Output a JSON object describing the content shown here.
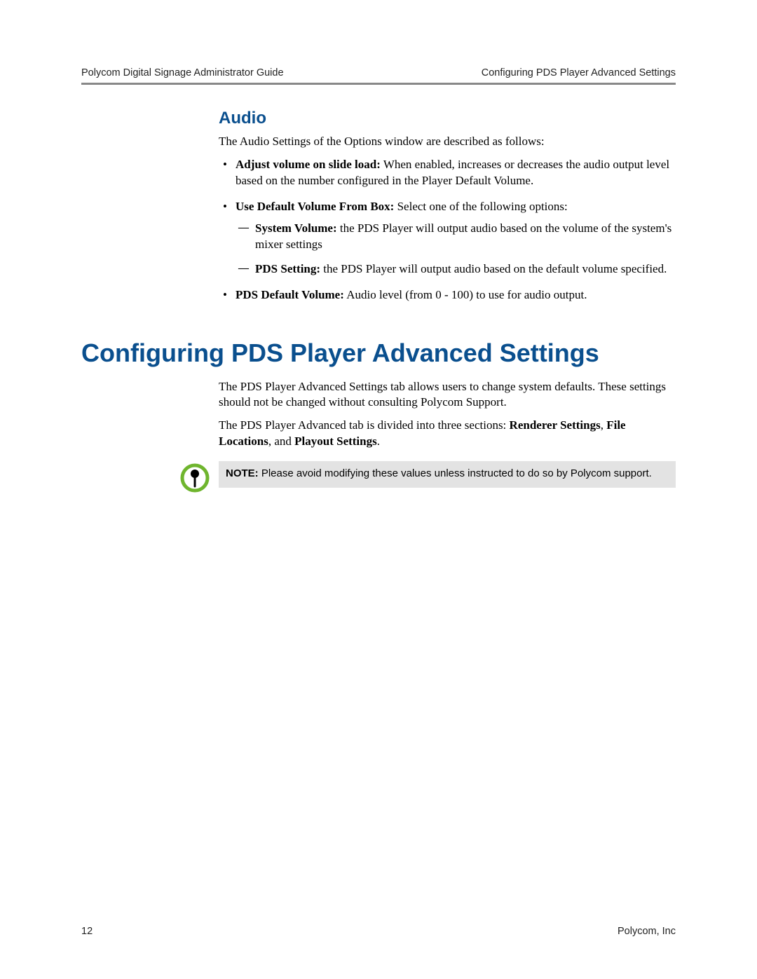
{
  "header": {
    "left": "Polycom Digital Signage Administrator Guide",
    "right": "Configuring PDS Player Advanced Settings"
  },
  "audio": {
    "heading": "Audio",
    "intro": "The Audio Settings of the Options window are described as follows:",
    "items": {
      "adjust": {
        "label": "Adjust volume on slide load:",
        "text": " When enabled, increases or decreases the audio output level based on the number configured in the Player Default Volume."
      },
      "usedefault": {
        "label": "Use Default Volume From Box:",
        "text": " Select one of the following options:",
        "sub": {
          "system": {
            "label": "System Volume:",
            "text": " the PDS Player will output audio based on the volume of the system's mixer settings"
          },
          "pds": {
            "label": "PDS Setting:",
            "text": " the PDS Player will output audio based on the default volume specified."
          }
        }
      },
      "defaultvol": {
        "label": "PDS Default Volume:",
        "text": " Audio level (from 0 - 100) to use for audio output."
      }
    }
  },
  "advanced": {
    "heading": "Configuring PDS Player Advanced Settings",
    "para1": "The PDS Player Advanced Settings tab allows users to change system defaults. These settings should not be changed without consulting Polycom Support.",
    "para2_start": "The PDS Player Advanced tab is divided into three sections: ",
    "para2_b1": "Renderer Settings",
    "para2_sep1": ", ",
    "para2_b2": "File Locations",
    "para2_sep2": ", and ",
    "para2_b3": "Playout Settings",
    "para2_end": "."
  },
  "note": {
    "label": "NOTE:",
    "text": " Please avoid modifying these values unless instructed to do so by Polycom support."
  },
  "footer": {
    "page": "12",
    "company": "Polycom, Inc"
  }
}
